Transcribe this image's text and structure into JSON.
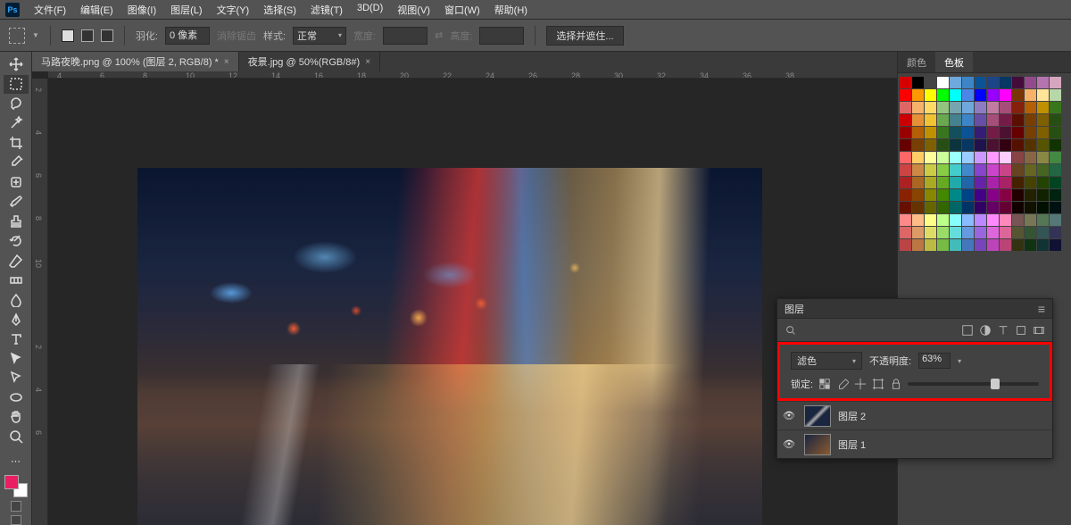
{
  "menu": {
    "items": [
      "文件(F)",
      "编辑(E)",
      "图像(I)",
      "图层(L)",
      "文字(Y)",
      "选择(S)",
      "滤镜(T)",
      "3D(D)",
      "视图(V)",
      "窗口(W)",
      "帮助(H)"
    ]
  },
  "options": {
    "feather_label": "羽化:",
    "feather_value": "0 像素",
    "antialias": "消除锯齿",
    "style_label": "样式:",
    "style_value": "正常",
    "width_label": "宽度:",
    "height_label": "高度:",
    "refine": "选择并遮住..."
  },
  "tabs": {
    "active": "马路夜晚.png @ 100% (图层 2, RGB/8) *",
    "inactive": "夜景.jpg @ 50%(RGB/8#)"
  },
  "ruler_h": [
    4,
    6,
    8,
    10,
    12,
    14,
    16,
    18,
    20,
    22,
    24,
    26,
    28,
    30,
    32,
    34,
    36,
    38
  ],
  "ruler_v": [
    2,
    4,
    6,
    8,
    10,
    "",
    "2",
    "4",
    "6"
  ],
  "right_tabs": {
    "color": "颜色",
    "swatches": "色板"
  },
  "layers": {
    "title": "图层",
    "blend_mode": "滤色",
    "opacity_label": "不透明度:",
    "opacity_value": "63%",
    "lock_label": "锁定:",
    "layer2": "图层 2",
    "layer1": "图层 1"
  },
  "swatch_colors": [
    "#d40000",
    "#000000",
    "#444444",
    "#ffffff",
    "#6fa8dc",
    "#3d85c6",
    "#0b5394",
    "#1c4587",
    "#073763",
    "#450c3a",
    "#934a8c",
    "#b573b0",
    "#d5a6bd",
    "#ff0000",
    "#ff9900",
    "#ffff00",
    "#00ff00",
    "#00ffff",
    "#4a86e8",
    "#0000ff",
    "#9900ff",
    "#ff00ff",
    "#793506",
    "#f6b26b",
    "#ffe599",
    "#b6d7a8",
    "#e06666",
    "#f6b26b",
    "#ffd966",
    "#93c47d",
    "#76a5af",
    "#6fa8dc",
    "#8e7cc3",
    "#c27ba0",
    "#a64d79",
    "#85200c",
    "#b45f06",
    "#bf9000",
    "#38761d",
    "#cc0000",
    "#e69138",
    "#f1c232",
    "#6aa84f",
    "#45818e",
    "#3d85c6",
    "#674ea7",
    "#a64d79",
    "#741b47",
    "#5b0f00",
    "#783f04",
    "#7f6000",
    "#274e13",
    "#990000",
    "#b45f06",
    "#bf9000",
    "#38761d",
    "#134f5c",
    "#0b5394",
    "#351c75",
    "#741b47",
    "#4c1130",
    "#660000",
    "#783f04",
    "#7f6000",
    "#274e13",
    "#660000",
    "#783f04",
    "#7f6000",
    "#274e13",
    "#0c343d",
    "#073763",
    "#20124d",
    "#4c1130",
    "#330011",
    "#551100",
    "#553300",
    "#555500",
    "#113300",
    "#ff6666",
    "#ffcc66",
    "#ffff99",
    "#ccff99",
    "#99ffff",
    "#99ccff",
    "#cc99ff",
    "#ff99ff",
    "#ffccff",
    "#884444",
    "#886644",
    "#888844",
    "#448844",
    "#cc4444",
    "#cc8844",
    "#cccc44",
    "#88cc44",
    "#44cccc",
    "#4488cc",
    "#8844cc",
    "#cc44cc",
    "#cc4488",
    "#664422",
    "#666622",
    "#446622",
    "#226644",
    "#aa2222",
    "#aa6622",
    "#aaaa22",
    "#66aa22",
    "#22aaaa",
    "#2266aa",
    "#6622aa",
    "#aa22aa",
    "#aa2266",
    "#442200",
    "#444400",
    "#224400",
    "#004422",
    "#882200",
    "#884400",
    "#888800",
    "#448800",
    "#008888",
    "#004488",
    "#440088",
    "#880088",
    "#880044",
    "#220000",
    "#222200",
    "#112200",
    "#002211",
    "#661100",
    "#663300",
    "#666600",
    "#336600",
    "#006666",
    "#003366",
    "#330066",
    "#660066",
    "#660033",
    "#110000",
    "#111100",
    "#001100",
    "#001111",
    "#ff8888",
    "#ffbb88",
    "#ffff88",
    "#bbff88",
    "#88ffff",
    "#88bbff",
    "#bb88ff",
    "#ff88ff",
    "#ff88bb",
    "#775555",
    "#777755",
    "#557755",
    "#557777",
    "#dd6666",
    "#dd9966",
    "#dddd66",
    "#99dd66",
    "#66dddd",
    "#6699dd",
    "#9966dd",
    "#dd66dd",
    "#dd6699",
    "#555533",
    "#335533",
    "#335555",
    "#333355",
    "#bb4444",
    "#bb7744",
    "#bbbb44",
    "#77bb44",
    "#44bbbb",
    "#4477bb",
    "#7744bb",
    "#bb44bb",
    "#bb4477",
    "#333311",
    "#113311",
    "#113333",
    "#111133"
  ]
}
